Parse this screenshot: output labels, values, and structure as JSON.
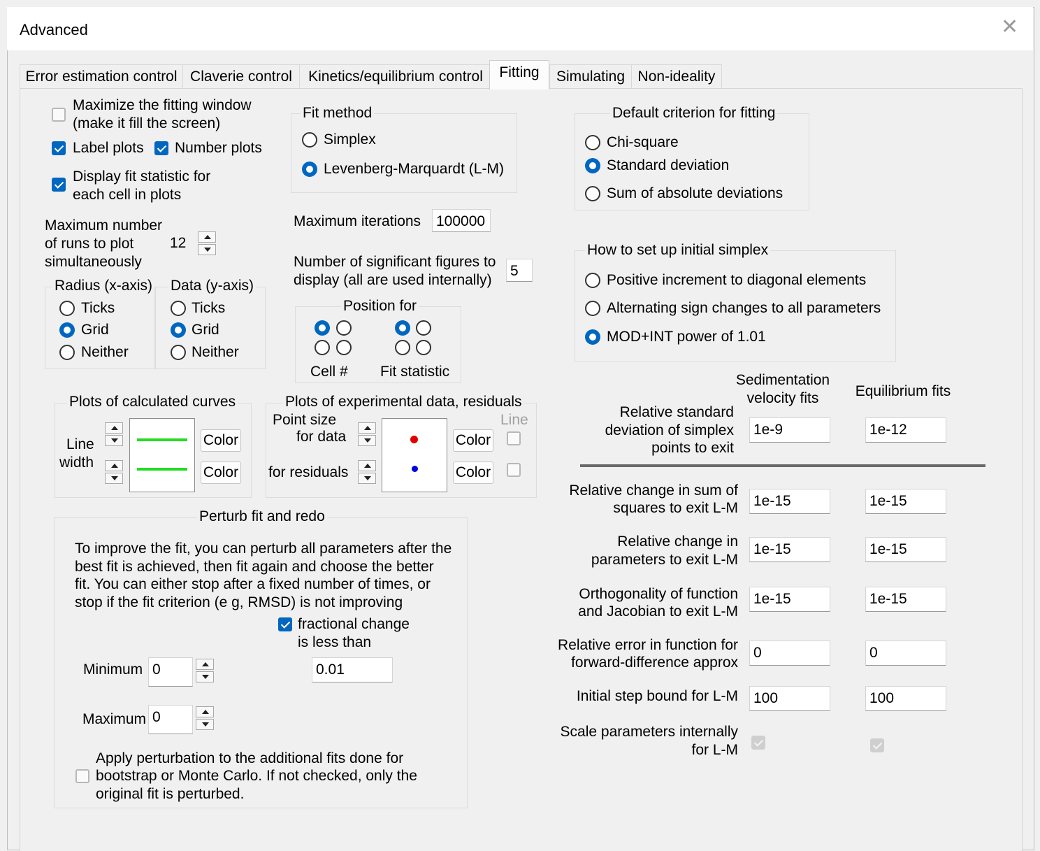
{
  "window": {
    "title": "Advanced"
  },
  "tabs": [
    "Error estimation control",
    "Claverie control",
    "Kinetics/equilibrium control",
    "Fitting",
    "Simulating",
    "Non-ideality"
  ],
  "left": {
    "maximize_line1": "Maximize the fitting window",
    "maximize_line2": "(make it fill the screen)",
    "label_plots": "Label plots",
    "number_plots": "Number plots",
    "display_stat_line1": "Display fit statistic for",
    "display_stat_line2": "each cell in plots",
    "max_runs_line1": "Maximum number",
    "max_runs_line2": "of runs to plot",
    "max_runs_line3": "simultaneously",
    "max_runs_value": "12",
    "radius_group": "Radius (x-axis)",
    "data_group": "Data (y-axis)",
    "opt_ticks": "Ticks",
    "opt_grid": "Grid",
    "opt_neither": "Neither"
  },
  "fit_method": {
    "title": "Fit method",
    "simplex": "Simplex",
    "lm": "Levenberg-Marquardt (L-M)"
  },
  "max_iter": {
    "label": "Maximum iterations",
    "value": "100000"
  },
  "sig_figs": {
    "line1": "Number of significant figures to",
    "line2": "display (all are used internally)",
    "value": "5"
  },
  "position": {
    "title": "Position for",
    "cell": "Cell #",
    "fit_stat": "Fit statistic"
  },
  "criterion": {
    "title": "Default criterion for fitting",
    "chi": "Chi-square",
    "sd": "Standard deviation",
    "sad": "Sum of absolute deviations"
  },
  "simplex_setup": {
    "title": "How to set up initial simplex",
    "opt1": "Positive increment to diagonal elements",
    "opt2": "Alternating sign changes to all parameters",
    "opt3": "MOD+INT power of 1.01"
  },
  "calc_curves": {
    "title": "Plots of calculated curves",
    "line": "Line",
    "width": "width",
    "color": "Color",
    "line_color": "#22dd22"
  },
  "exp_data": {
    "title": "Plots of experimental data, residuals",
    "point_size": "Point size",
    "for_data": "for data",
    "for_residuals": "for residuals",
    "color": "Color",
    "line": "Line",
    "data_color": "#e00000",
    "resid_color": "#0000dd"
  },
  "perturb": {
    "title": "Perturb fit and redo",
    "desc1": "To improve the fit, you can perturb all parameters after the",
    "desc2": "best fit is achieved, then fit again and choose the better",
    "desc3": "fit. You can either stop after a fixed number of times, or",
    "desc4": "stop if the fit criterion (e g, RMSD) is not improving",
    "frac1": "fractional change",
    "frac2": "is less than",
    "frac_value": "0.01",
    "minimum": "Minimum",
    "min_value": "0",
    "maximum": "Maximum",
    "max_value": "0",
    "apply1": "Apply perturbation to the additional fits done for",
    "apply2": "bootstrap or Monte Carlo. If not checked, only the",
    "apply3": "original fit is perturbed."
  },
  "tolerances": {
    "col_sv1": "Sedimentation",
    "col_sv2": "velocity fits",
    "col_eq": "Equilibrium fits",
    "rows": [
      {
        "l1": "Relative standard",
        "l2": "deviation of simplex",
        "l3": "points to exit",
        "sv": "1e-9",
        "eq": "1e-12"
      },
      {
        "l1": "Relative change in sum of",
        "l2": "squares to exit L-M",
        "sv": "1e-15",
        "eq": "1e-15"
      },
      {
        "l1": "Relative change in",
        "l2": "parameters to exit L-M",
        "sv": "1e-15",
        "eq": "1e-15"
      },
      {
        "l1": "Orthogonality of function",
        "l2": "and Jacobian to exit L-M",
        "sv": "1e-15",
        "eq": "1e-15"
      },
      {
        "l1": "Relative error in function for",
        "l2": "forward-difference approx",
        "sv": "0",
        "eq": "0"
      },
      {
        "l1": "Initial step bound for L-M",
        "sv": "100",
        "eq": "100"
      },
      {
        "l1": "Scale parameters internally",
        "l2": "for L-M"
      }
    ]
  }
}
